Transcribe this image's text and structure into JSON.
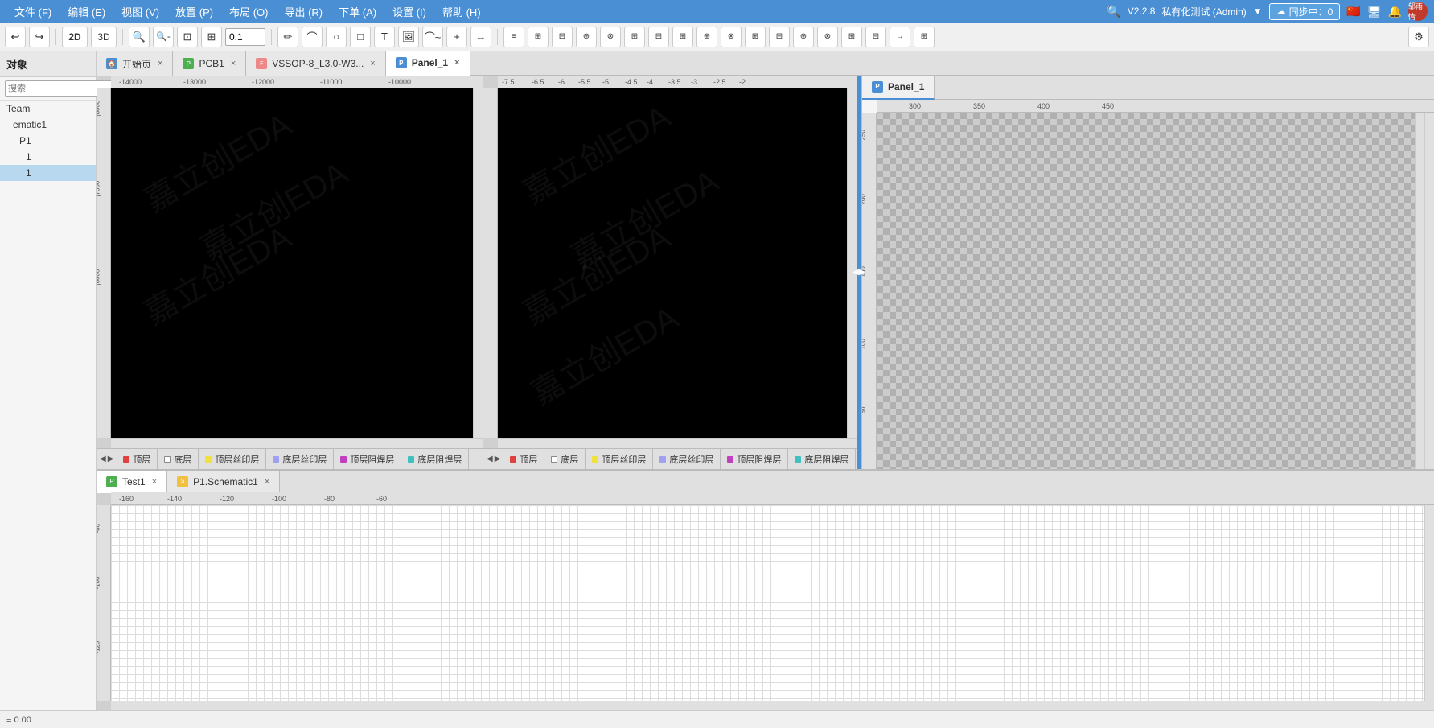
{
  "menuBar": {
    "items": [
      "文件 (F)",
      "编辑 (E)",
      "视图 (V)",
      "放置 (P)",
      "布局 (O)",
      "导出 (R)",
      "下单 (A)",
      "设置 (I)",
      "帮助 (H)"
    ],
    "right": {
      "version": "V2.2.8",
      "user": "私有化测试 (Admin)",
      "sync": "同步中：0",
      "username": "邹雨情"
    }
  },
  "toolbar": {
    "zoomValue": "0.1",
    "undoLabel": "↩",
    "redoLabel": "↪",
    "twoD": "2D",
    "threeD": "3D"
  },
  "sidebar": {
    "header": "对象",
    "searchPlaceholder": "搜索",
    "items": [
      {
        "label": "Team",
        "level": 0
      },
      {
        "label": "ematic1",
        "level": 1
      },
      {
        "label": "P1",
        "level": 2
      },
      {
        "label": "1",
        "level": 3
      },
      {
        "label": "1",
        "level": 3,
        "active": true
      }
    ]
  },
  "tabs": [
    {
      "id": "start",
      "label": "开始页",
      "icon": "home",
      "color": "#4a8fd4",
      "active": false
    },
    {
      "id": "pcb1",
      "label": "PCB1",
      "icon": "pcb",
      "color": "#4CAF50",
      "active": false
    },
    {
      "id": "vssop",
      "label": "VSSOP-8_L3.0-W3...",
      "icon": "footprint",
      "color": "#e88",
      "active": false
    },
    {
      "id": "panel1",
      "label": "Panel_1",
      "icon": "panel",
      "color": "#4a8fd4",
      "active": true
    }
  ],
  "bottomTabs": [
    {
      "id": "test1",
      "label": "Test1",
      "icon": "pcb",
      "color": "#4CAF50",
      "active": true
    },
    {
      "id": "p1schematic",
      "label": "P1.Schematic1",
      "icon": "schematic",
      "color": "#e88",
      "active": false
    }
  ],
  "leftPaneBottomLayers": [
    {
      "label": "顶层",
      "color": "#e04040"
    },
    {
      "label": "底层",
      "color": "#f0f0f0",
      "border": "#888"
    },
    {
      "label": "顶层丝印层",
      "color": "#f0e040"
    },
    {
      "label": "底层丝印层",
      "color": "#a0a0f0"
    },
    {
      "label": "顶层阻焊层",
      "color": "#c040c0"
    },
    {
      "label": "底层阻焊层",
      "color": "#40c0c0"
    }
  ],
  "rightPaneBottomLayers": [
    {
      "label": "顶层",
      "color": "#e04040"
    },
    {
      "label": "底层",
      "color": "#f0f0f0",
      "border": "#888"
    },
    {
      "label": "顶层丝印层",
      "color": "#f0e040"
    },
    {
      "label": "底层丝印层",
      "color": "#a0a0f0"
    },
    {
      "label": "顶层阻焊层",
      "color": "#c040c0"
    },
    {
      "label": "底层阻焊层",
      "color": "#40c0c0"
    }
  ],
  "panelTab": {
    "label": "Panel_1",
    "icon": "panel"
  },
  "rulers": {
    "pcbHorizontal": [
      "-14000",
      "-13000",
      "-12000",
      "-11000",
      "-10000"
    ],
    "footprintHorizontal": [
      "-7.5",
      "-6.5",
      "-6",
      "-5.5",
      "-5",
      "-4.5",
      "-4",
      "-3.5",
      "-3",
      "-2.5",
      "-2"
    ],
    "panelHorizontal": [
      "300",
      "350",
      "400",
      "450"
    ],
    "bottomHorizontal": [
      "-160",
      "-140",
      "-120",
      "-100",
      "-80",
      "-60"
    ]
  },
  "statusBar": {
    "coords": "≡ 0:00"
  },
  "gearIconLabel": "⚙"
}
